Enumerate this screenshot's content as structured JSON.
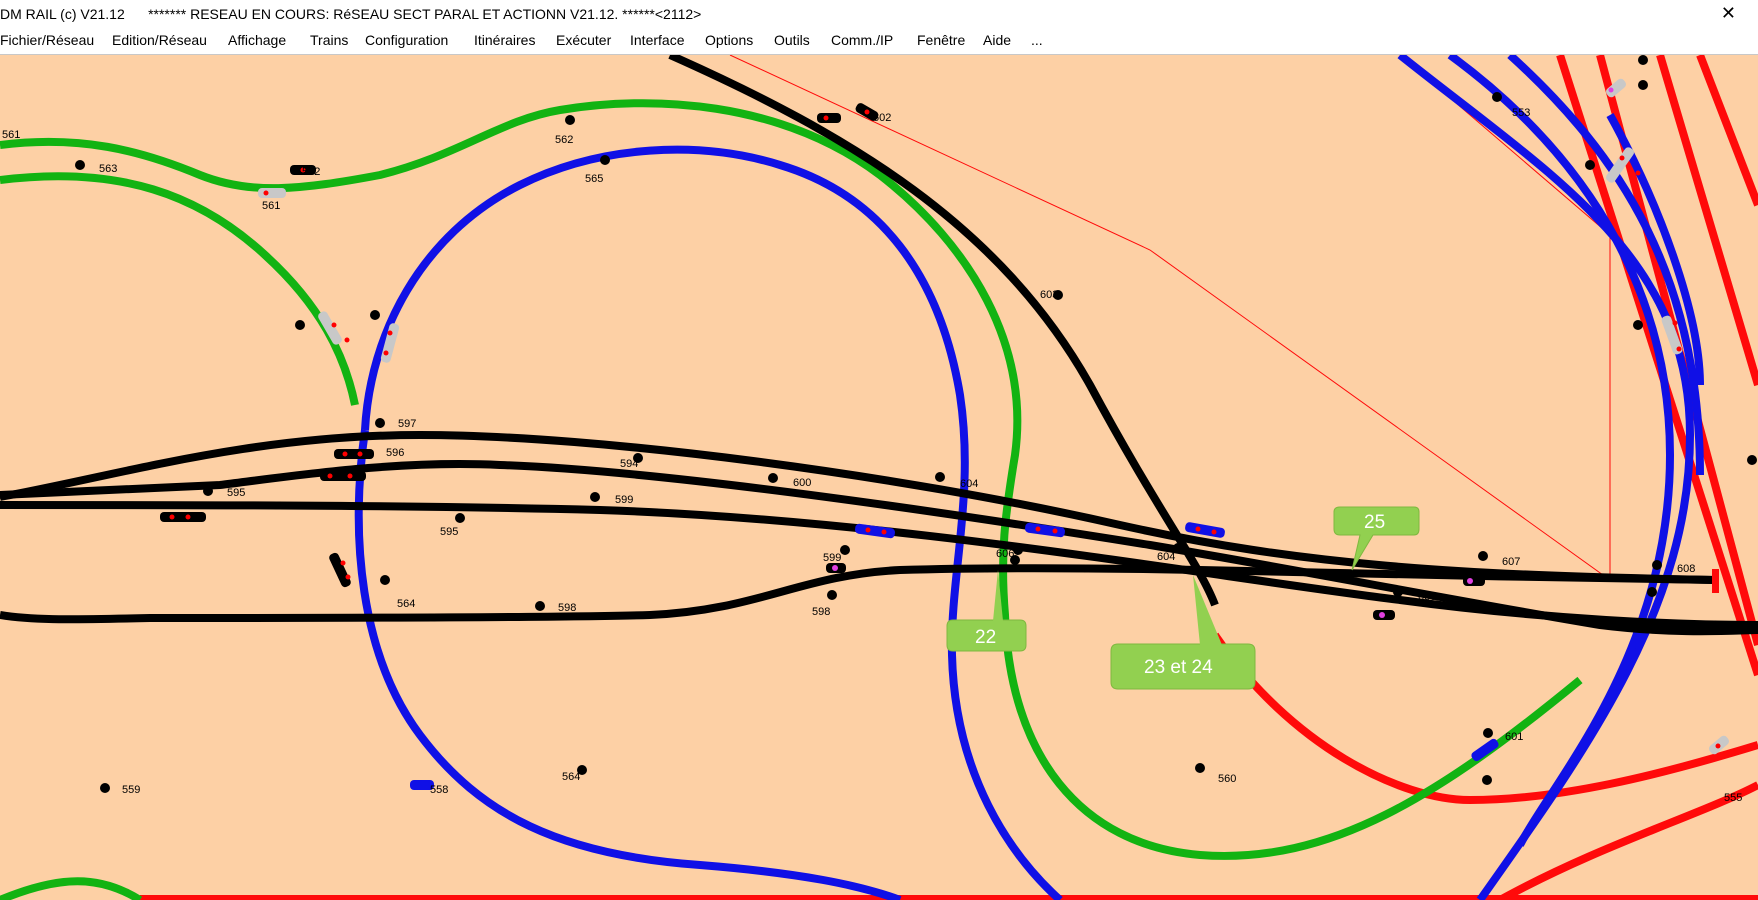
{
  "window": {
    "title": "DM RAIL (c) V21.12      ******* RESEAU EN COURS: RéSEAU SECT PARAL ET ACTIONN V21.12. ******<2112>",
    "close_icon": "close-icon"
  },
  "menu": {
    "items": [
      "Fichier/Réseau",
      "Edition/Réseau",
      "Affichage",
      "Trains",
      "Configuration",
      "Itinéraires",
      "Exécuter",
      "Interface",
      "Options",
      "Outils",
      "Comm./IP",
      "Fenêtre",
      "Aide",
      "..."
    ]
  },
  "colors": {
    "background": "#fdd0a5",
    "track_black": "#000000",
    "track_green": "#12b312",
    "track_blue": "#1010e6",
    "track_red": "#ff0a0a",
    "callout": "#92d050",
    "signal_red": "#ff0000"
  },
  "track_labels": [
    "561",
    "563",
    "562",
    "561",
    "562",
    "565",
    "602",
    "603",
    "553",
    "597",
    "596",
    "595",
    "595",
    "600",
    "599",
    "594",
    "604",
    "599",
    "598",
    "564",
    "598",
    "606",
    "604",
    "607",
    "605",
    "608",
    "601",
    "560",
    "559",
    "558",
    "564",
    "555"
  ],
  "callouts": [
    "25",
    "22",
    "23 et 24"
  ]
}
